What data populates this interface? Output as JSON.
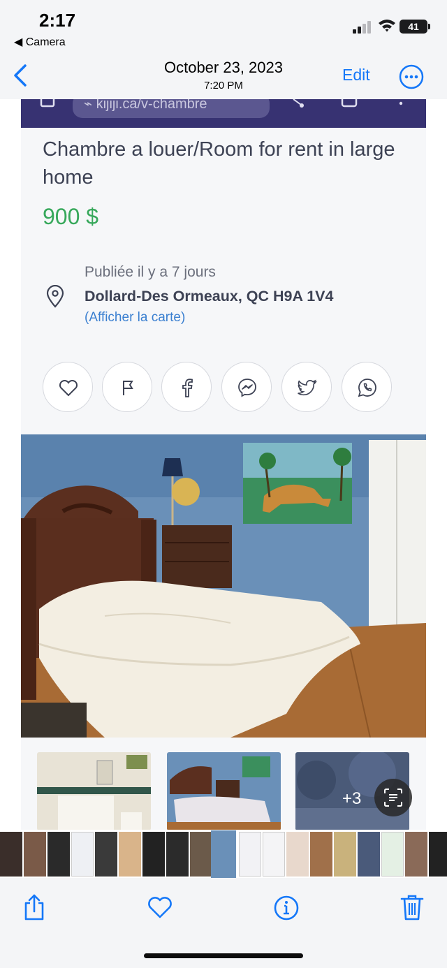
{
  "status_bar": {
    "time": "2:17",
    "back_app": "◀ Camera",
    "battery": "41"
  },
  "nav": {
    "date": "October 23, 2023",
    "time": "7:20 PM",
    "edit_label": "Edit"
  },
  "screenshot": {
    "url_fragment": "⌁ kijiji.ca/v-chambre",
    "listing": {
      "title": "Chambre a louer/Room for rent in large home",
      "price": "900 $",
      "posted": "Publiée il y a 7 jours",
      "address": "Dollard-Des Ormeaux, QC H9A 1V4",
      "map_link": "(Afficher la carte)"
    },
    "share_buttons": [
      "favorite-icon",
      "flag-icon",
      "facebook-icon",
      "messenger-icon",
      "twitter-icon",
      "whatsapp-icon"
    ],
    "more_photos": "+3"
  },
  "colors": {
    "kijiji_header": "#373272",
    "price_green": "#37a85b",
    "ios_blue": "#1477f8",
    "link_blue": "#3a7fd0"
  },
  "toolbar": [
    "share-icon",
    "heart-icon",
    "info-icon",
    "trash-icon"
  ]
}
